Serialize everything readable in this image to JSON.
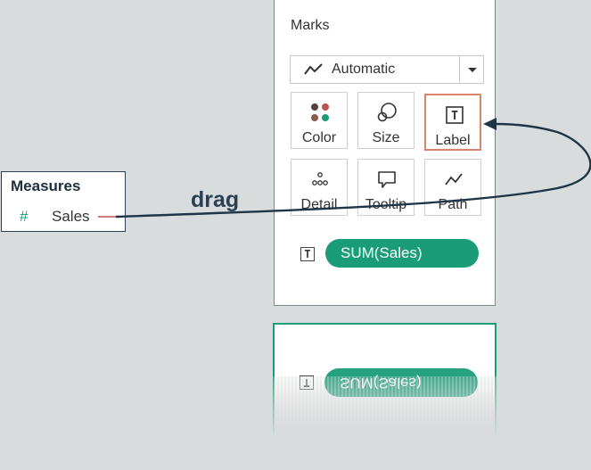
{
  "marks": {
    "title": "Marks",
    "mark_type": {
      "label": "Automatic",
      "icon": "line-chart-icon"
    },
    "buttons": [
      {
        "label": "Color",
        "icon": "color-dots-icon",
        "selected": false
      },
      {
        "label": "Size",
        "icon": "size-circles-icon",
        "selected": false
      },
      {
        "label": "Label",
        "icon": "text-label-icon",
        "selected": true
      },
      {
        "label": "Detail",
        "icon": "detail-dots-icon",
        "selected": false
      },
      {
        "label": "Tooltip",
        "icon": "tooltip-bubble-icon",
        "selected": false
      },
      {
        "label": "Path",
        "icon": "path-line-icon",
        "selected": false
      }
    ],
    "pill": {
      "icon_text": "T",
      "label": "SUM(Sales)"
    }
  },
  "measures": {
    "header": "Measures",
    "field_symbol": "#",
    "field": "Sales"
  },
  "annotation": {
    "drag_text": "drag"
  },
  "reflection": {
    "icon_text": "T",
    "label": "SUM(Sales)"
  },
  "colors": {
    "accent_green": "#1a9d77",
    "selected_border": "#d9826e",
    "arrow": "#1f3547",
    "background": "#d9dcdc"
  }
}
